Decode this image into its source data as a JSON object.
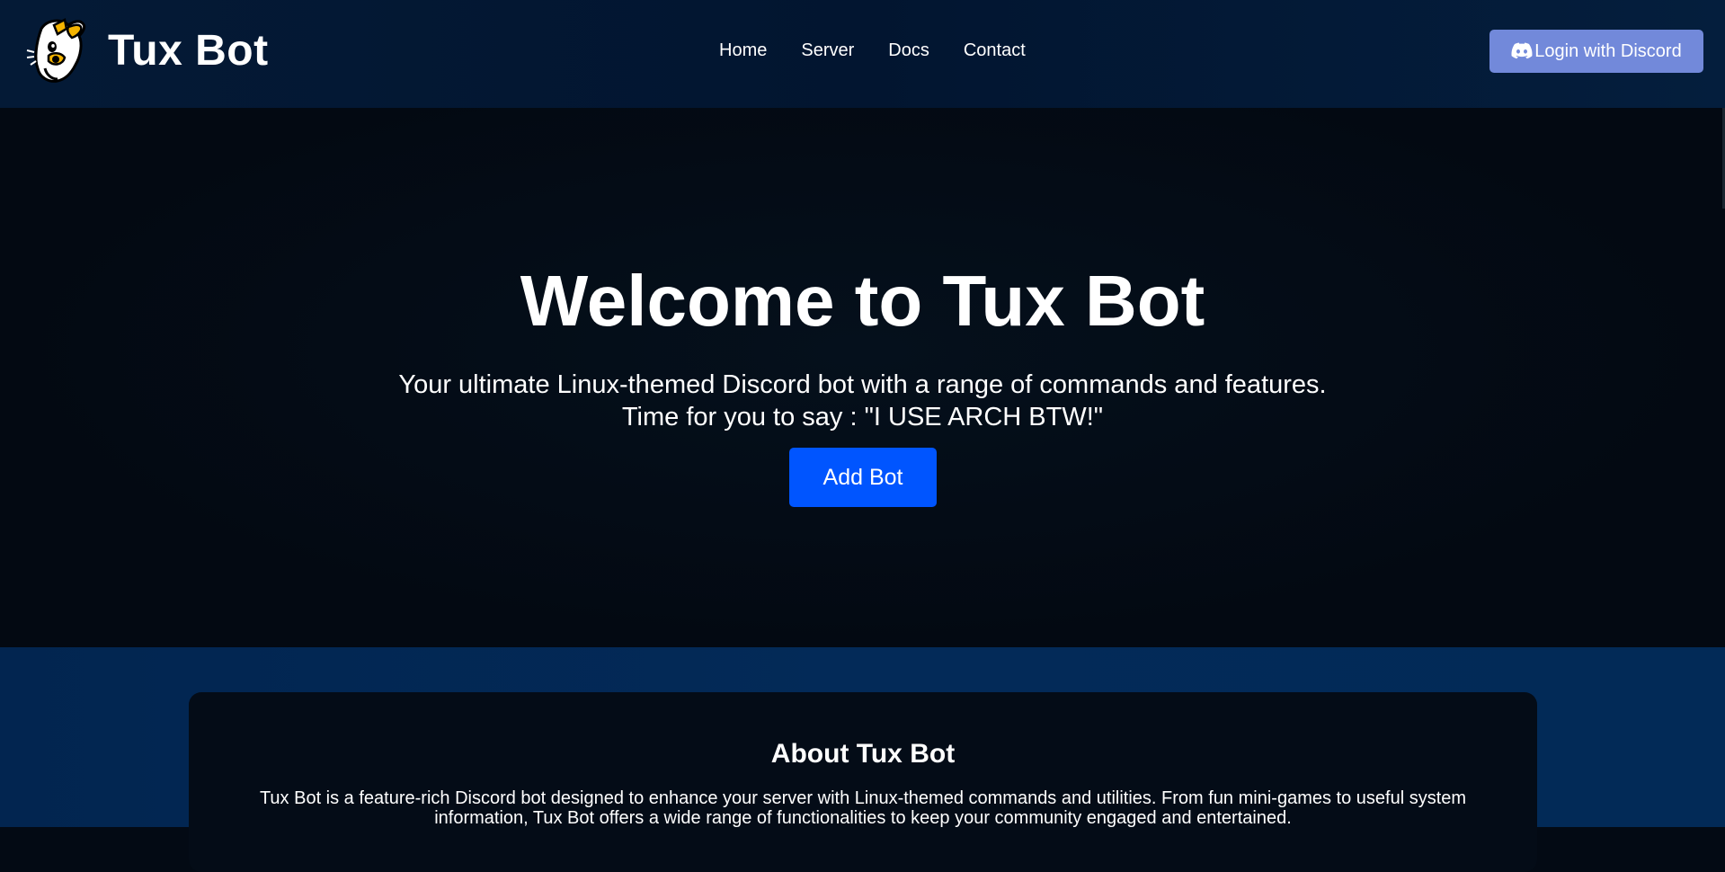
{
  "brand": {
    "name": "Tux Bot",
    "logo_icon": "tux-penguin-logo"
  },
  "nav": {
    "links": [
      {
        "label": "Home"
      },
      {
        "label": "Server"
      },
      {
        "label": "Docs"
      },
      {
        "label": "Contact"
      }
    ],
    "login_label": "Login with Discord",
    "login_icon": "discord-icon"
  },
  "hero": {
    "title": "Welcome to Tux Bot",
    "subtitle_line1": "Your ultimate Linux-themed Discord bot with a range of commands and features.",
    "subtitle_line2": "Time for you to say : \"I USE ARCH BTW!\"",
    "add_bot_label": "Add Bot"
  },
  "about": {
    "title": "About Tux Bot",
    "text": "Tux Bot is a feature-rich Discord bot designed to enhance your server with Linux-themed commands and utilities. From fun mini-games to useful system information, Tux Bot offers a wide range of functionalities to keep your community engaged and entertained."
  },
  "colors": {
    "accent": "#0055ff",
    "discord": "#7289da",
    "navbar": "#03183a",
    "hero_bg": "#030a14"
  }
}
